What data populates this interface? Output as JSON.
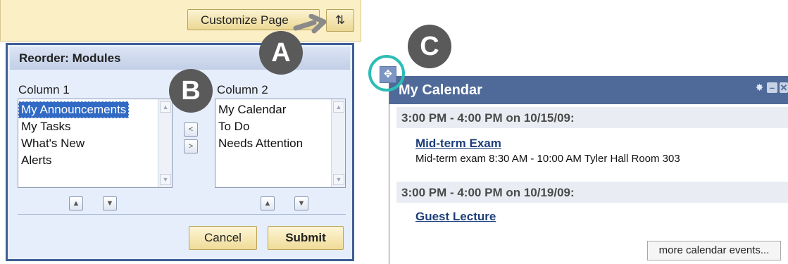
{
  "toolbar": {
    "customize_label": "Customize Page",
    "reorder_icon": "up-down-arrows-icon",
    "reorder_glyph": "⇅"
  },
  "reorder_dialog": {
    "title": "Reorder: Modules",
    "column1": {
      "label": "Column 1",
      "items": [
        "My Announcements",
        "My Tasks",
        "What's New",
        "Alerts"
      ],
      "selected": "My Announcements"
    },
    "column2": {
      "label": "Column 2",
      "items": [
        "My Calendar",
        "To Do",
        "Needs Attention"
      ]
    },
    "move_left_glyph": "<",
    "move_right_glyph": ">",
    "move_up_glyph": "^",
    "move_down_glyph": "v",
    "cancel_label": "Cancel",
    "submit_label": "Submit"
  },
  "calendar": {
    "title": "My Calendar",
    "move_glyph": "✥",
    "header_icons": [
      "gear-icon",
      "minimize-icon",
      "close-icon"
    ],
    "events": [
      {
        "date": "3:00 PM - 4:00 PM on 10/15/09:",
        "title": "Mid-term Exam",
        "description": "Mid-term exam 8:30 AM - 10:00 AM Tyler Hall Room 303"
      },
      {
        "date": "3:00 PM - 4:00 PM on 10/19/09:",
        "title": "Guest Lecture",
        "description": ""
      }
    ],
    "more_label": "more calendar events..."
  },
  "markers": {
    "a": "A",
    "b": "B",
    "c": "C"
  },
  "colors": {
    "accent_header": "#4f6a99",
    "panel_border": "#3f5e94",
    "button_gold": "#f0dc97",
    "highlight_teal": "#2cbdb6",
    "marker_gray": "#5a5a5a"
  }
}
